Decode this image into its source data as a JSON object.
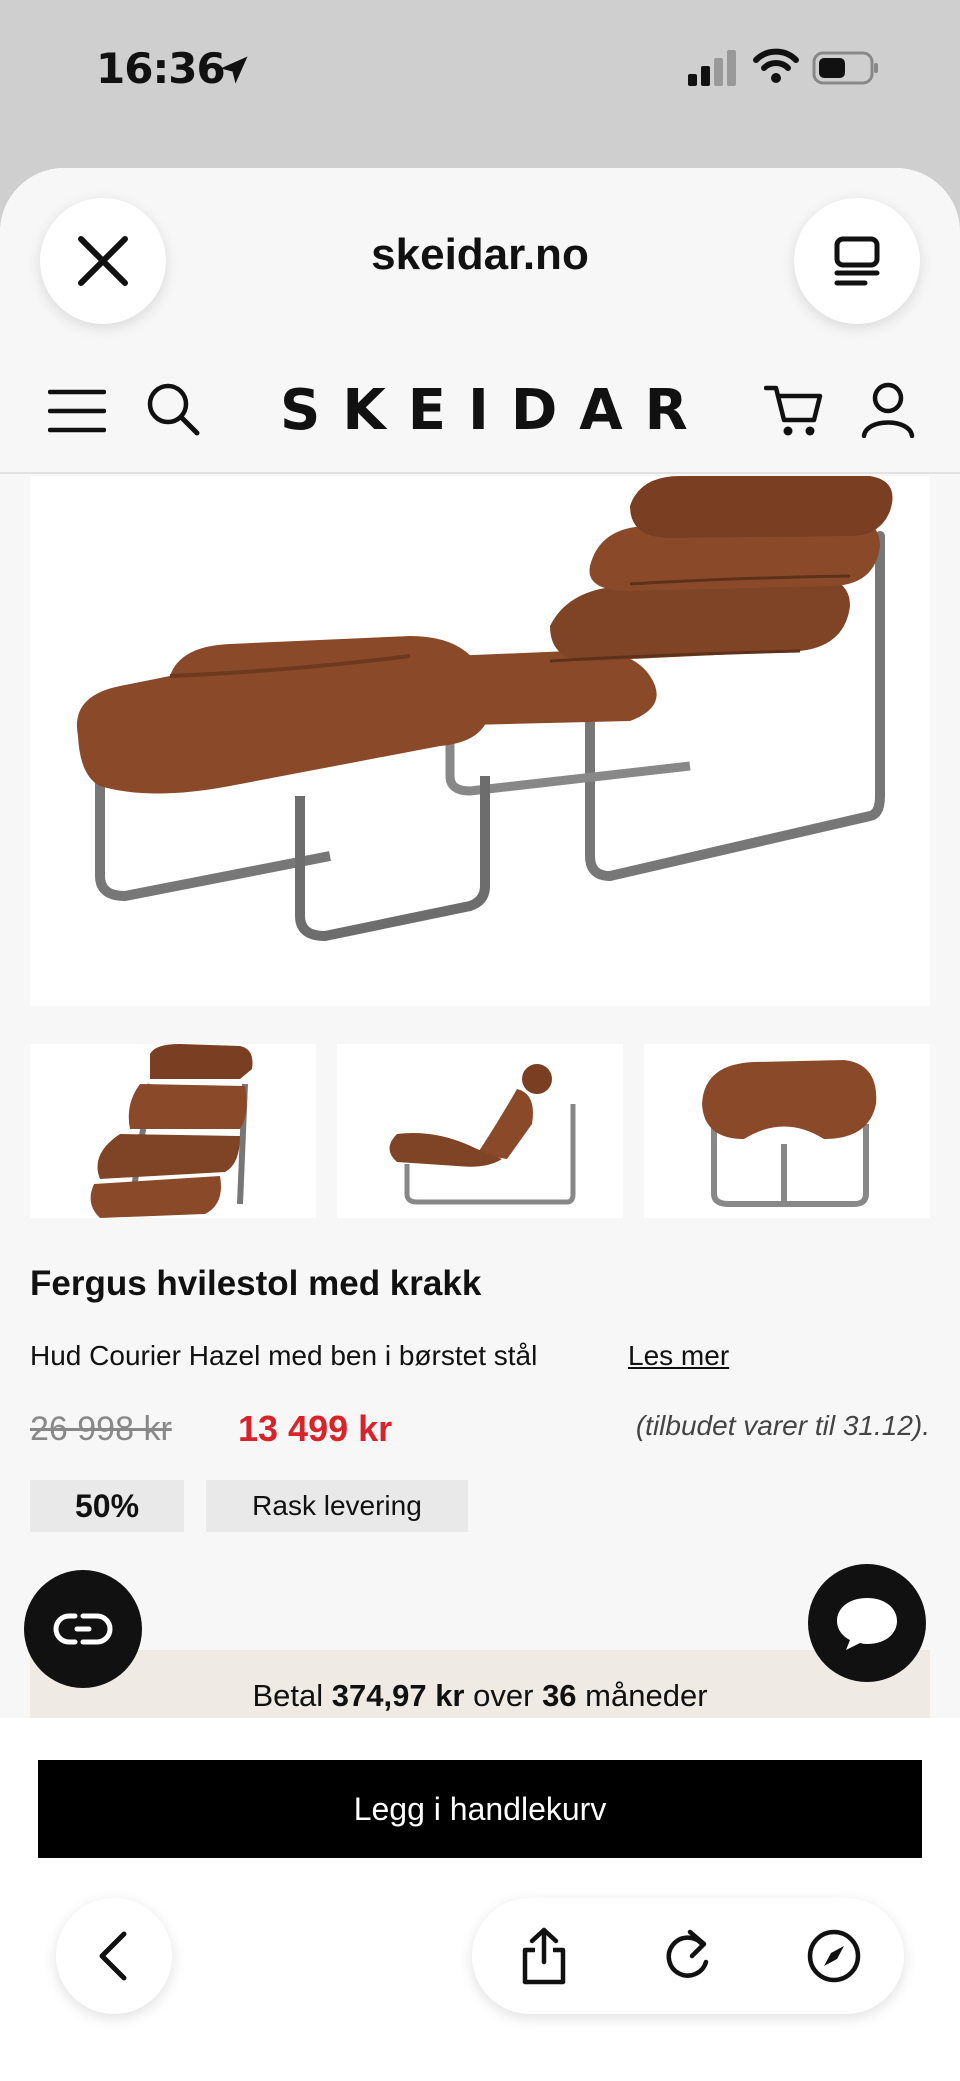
{
  "status_bar": {
    "time": "16:36"
  },
  "browser": {
    "domain": "skeidar.no"
  },
  "site": {
    "logo": "SKEIDAR"
  },
  "product": {
    "title": "Fergus hvilestol med krakk",
    "description": "Hud Courier Hazel med ben i børstet stål",
    "read_more": "Les mer",
    "old_price": "26 998 kr",
    "new_price": "13 499 kr",
    "offer_note": "(tilbudet varer til 31.12).",
    "discount_badge": "50%",
    "delivery_badge": "Rask levering"
  },
  "finance": {
    "prefix": "Betal",
    "amount": "374,97 kr",
    "middle": "over",
    "months": "36",
    "suffix": "måneder"
  },
  "actions": {
    "add_to_cart": "Legg i handlekurv"
  },
  "colors": {
    "sale_price": "#d9222a",
    "leather": "#8a4a2a",
    "button": "#000000"
  },
  "icons": [
    "location-arrow-icon",
    "signal-icon",
    "wifi-icon",
    "battery-icon",
    "close-icon",
    "tabs-icon",
    "menu-icon",
    "search-icon",
    "cart-icon",
    "user-icon",
    "loop-icon",
    "chat-icon",
    "chevron-left-icon",
    "share-icon",
    "reload-icon",
    "compass-icon"
  ]
}
